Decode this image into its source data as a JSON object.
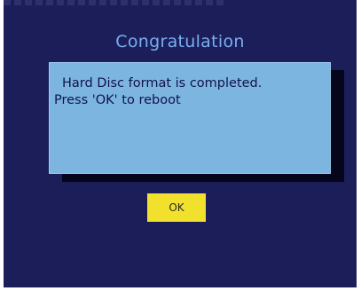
{
  "dialog": {
    "title": "Congratulation",
    "message_line1": "Hard Disc format is completed.",
    "message_line2": "Press 'OK' to reboot",
    "ok_label": "OK"
  },
  "colors": {
    "background": "#1c1e5a",
    "title": "#7aaef0",
    "message_box": "#7cb6e0",
    "message_text": "#12124a",
    "ok_button": "#f2e12c"
  }
}
